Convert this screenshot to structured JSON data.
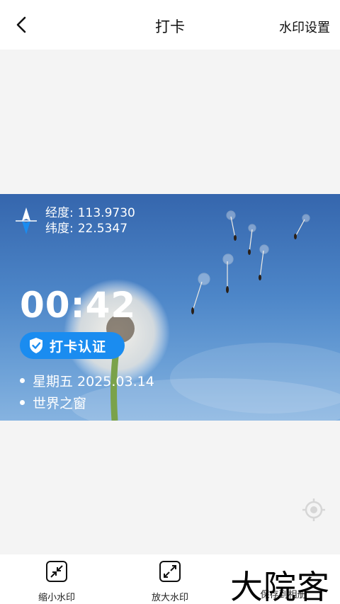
{
  "header": {
    "title": "打卡",
    "settings_label": "水印设置"
  },
  "watermark": {
    "longitude_label": "经度:",
    "longitude_value": "113.9730",
    "latitude_label": "纬度:",
    "latitude_value": "22.5347",
    "time": "00:42",
    "badge_label": "打卡认证",
    "date_line": "星期五 2025.03.14",
    "location_line": "世界之窗"
  },
  "toolbar": {
    "shrink_label": "缩小水印",
    "enlarge_label": "放大水印",
    "save_label": "保存到相册"
  },
  "overlay_logo": "大院客",
  "colors": {
    "accent": "#1a8cf0",
    "sky": "#4d86c8"
  }
}
